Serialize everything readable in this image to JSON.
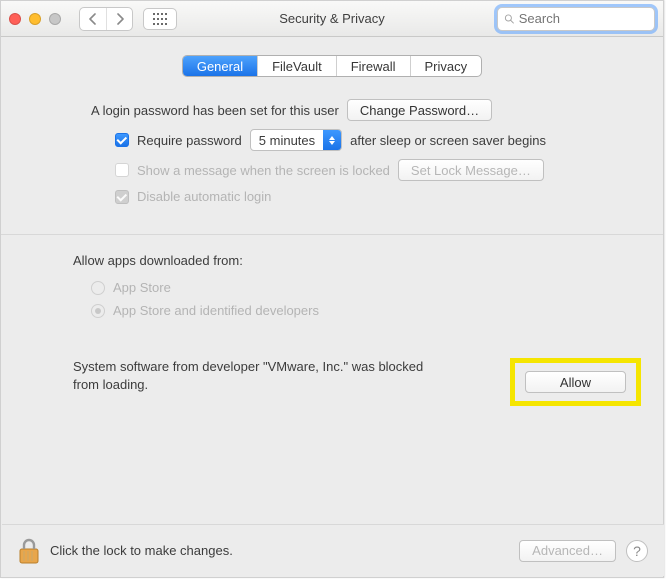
{
  "header": {
    "title": "Security & Privacy",
    "search_placeholder": "Search"
  },
  "tabs": {
    "general": "General",
    "filevault": "FileVault",
    "firewall": "Firewall",
    "privacy": "Privacy"
  },
  "login": {
    "password_set_label": "A login password has been set for this user",
    "change_password_button": "Change Password…",
    "require_password_label": "Require password",
    "delay_value": "5 minutes",
    "after_sleep_label": "after sleep or screen saver begins",
    "show_message_label": "Show a message when the screen is locked",
    "set_lock_message_button": "Set Lock Message…",
    "disable_auto_login_label": "Disable automatic login"
  },
  "gatekeeper": {
    "heading": "Allow apps downloaded from:",
    "option_app_store": "App Store",
    "option_identified": "App Store and identified developers"
  },
  "kext": {
    "message": "System software from developer \"VMware, Inc.\" was blocked from loading.",
    "allow_button": "Allow"
  },
  "footer": {
    "lock_text": "Click the lock to make changes.",
    "advanced_button": "Advanced…",
    "help_button": "?"
  }
}
